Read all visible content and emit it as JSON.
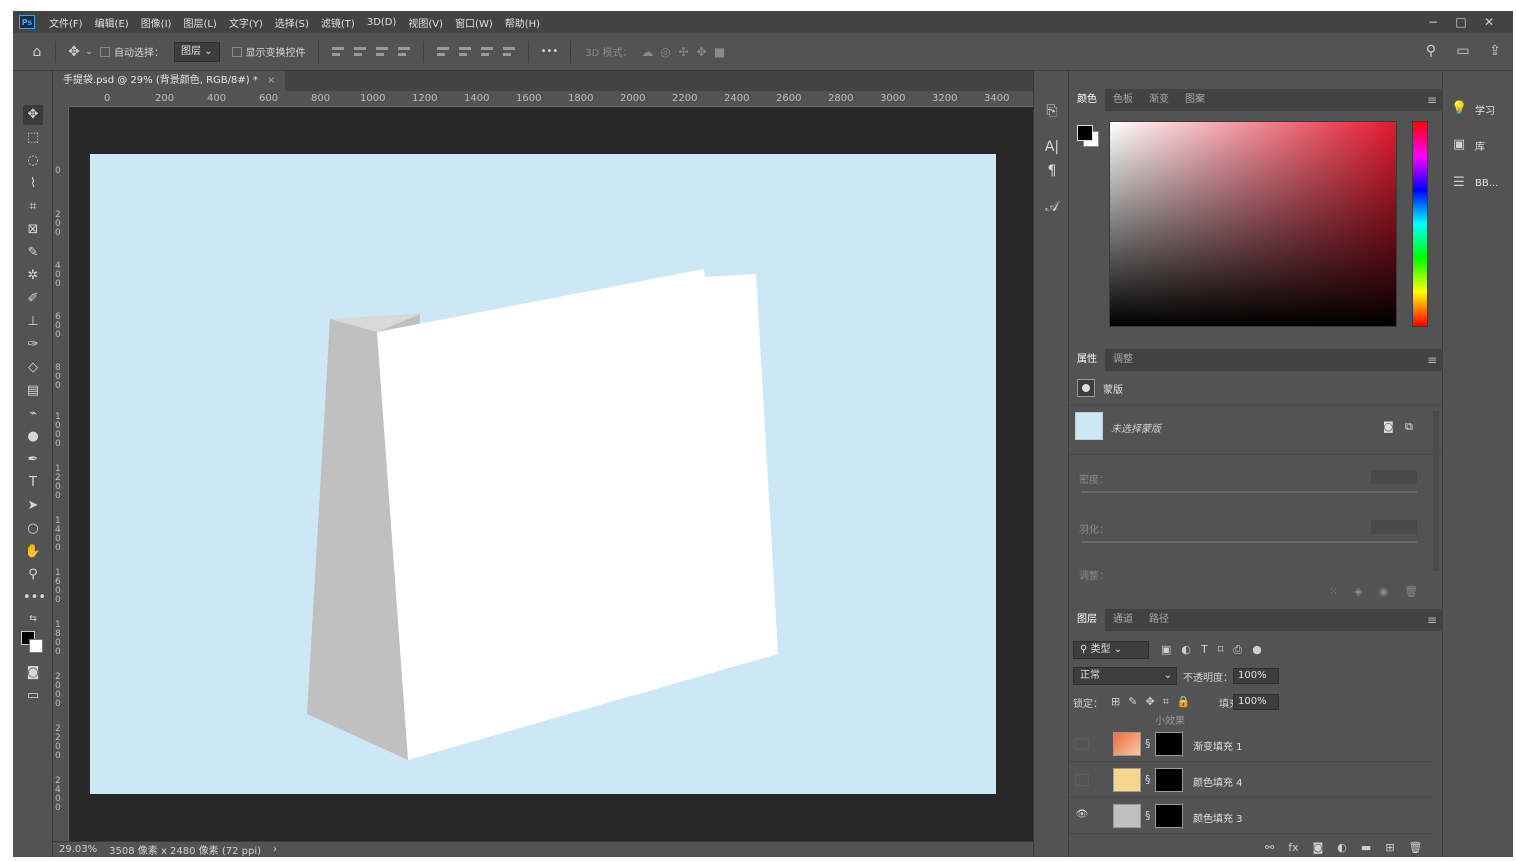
{
  "menu": {
    "logo": "Ps",
    "items": [
      "文件(F)",
      "编辑(E)",
      "图像(I)",
      "图层(L)",
      "文字(Y)",
      "选择(S)",
      "滤镜(T)",
      "3D(D)",
      "视图(V)",
      "窗口(W)",
      "帮助(H)"
    ]
  },
  "options": {
    "auto_select_label": "自动选择：",
    "auto_select_value": "图层",
    "show_transform_label": "显示变换控件",
    "more": "•••",
    "mode_3d_label": "3D 模式："
  },
  "document": {
    "tab_title": "手提袋.psd @ 29% (背景颜色, RGB/8#) *",
    "tab_close": "×",
    "ruler_h": [
      "0",
      "200",
      "400",
      "600",
      "800",
      "1000",
      "1200",
      "1400",
      "1600",
      "1800",
      "2000",
      "2200",
      "2400",
      "2600",
      "2800",
      "3000",
      "3200",
      "3400"
    ],
    "ruler_v": [
      "0",
      "2 0 0",
      "4 0 0",
      "6 0 0",
      "8 0 0",
      "1 0 0 0",
      "1 2 0 0",
      "1 4 0 0",
      "1 6 0 0",
      "1 8 0 0",
      "2 0 0 0",
      "2 2 0 0",
      "2 4 0 0"
    ],
    "canvas_color": "#cde8f4",
    "status_zoom": "29.03%",
    "status_info": "3508 像素 x 2480 像素 (72 ppi)",
    "status_arrow": "›"
  },
  "color_panel": {
    "tabs": [
      "颜色",
      "色板",
      "渐变",
      "图案"
    ],
    "active_tab": "颜色"
  },
  "properties_panel": {
    "tabs": [
      "属性",
      "调整"
    ],
    "header": "蒙版",
    "mask_label": "未选择蒙版",
    "density_label": "密度：",
    "feather_label": "羽化：",
    "adjust_label": "调整："
  },
  "layers_panel": {
    "tabs": [
      "图层",
      "通道",
      "路径"
    ],
    "filter_kind": "类型",
    "blend_mode": "正常",
    "opacity_label": "不透明度：",
    "opacity_value": "100%",
    "lock_label": "锁定：",
    "fill_label": "填充：",
    "fill_value": "100%",
    "partial_row": "小效果",
    "layers": [
      {
        "name": "渐变填充 1",
        "visible": false,
        "thumb": "gradient-orange"
      },
      {
        "name": "颜色填充 4",
        "visible": false,
        "thumb": "#f7d58c"
      },
      {
        "name": "颜色填充 3",
        "visible": true,
        "thumb": "#c0c0c0"
      }
    ]
  },
  "right_dock": {
    "items": [
      "学习",
      "库",
      "BB..."
    ]
  }
}
